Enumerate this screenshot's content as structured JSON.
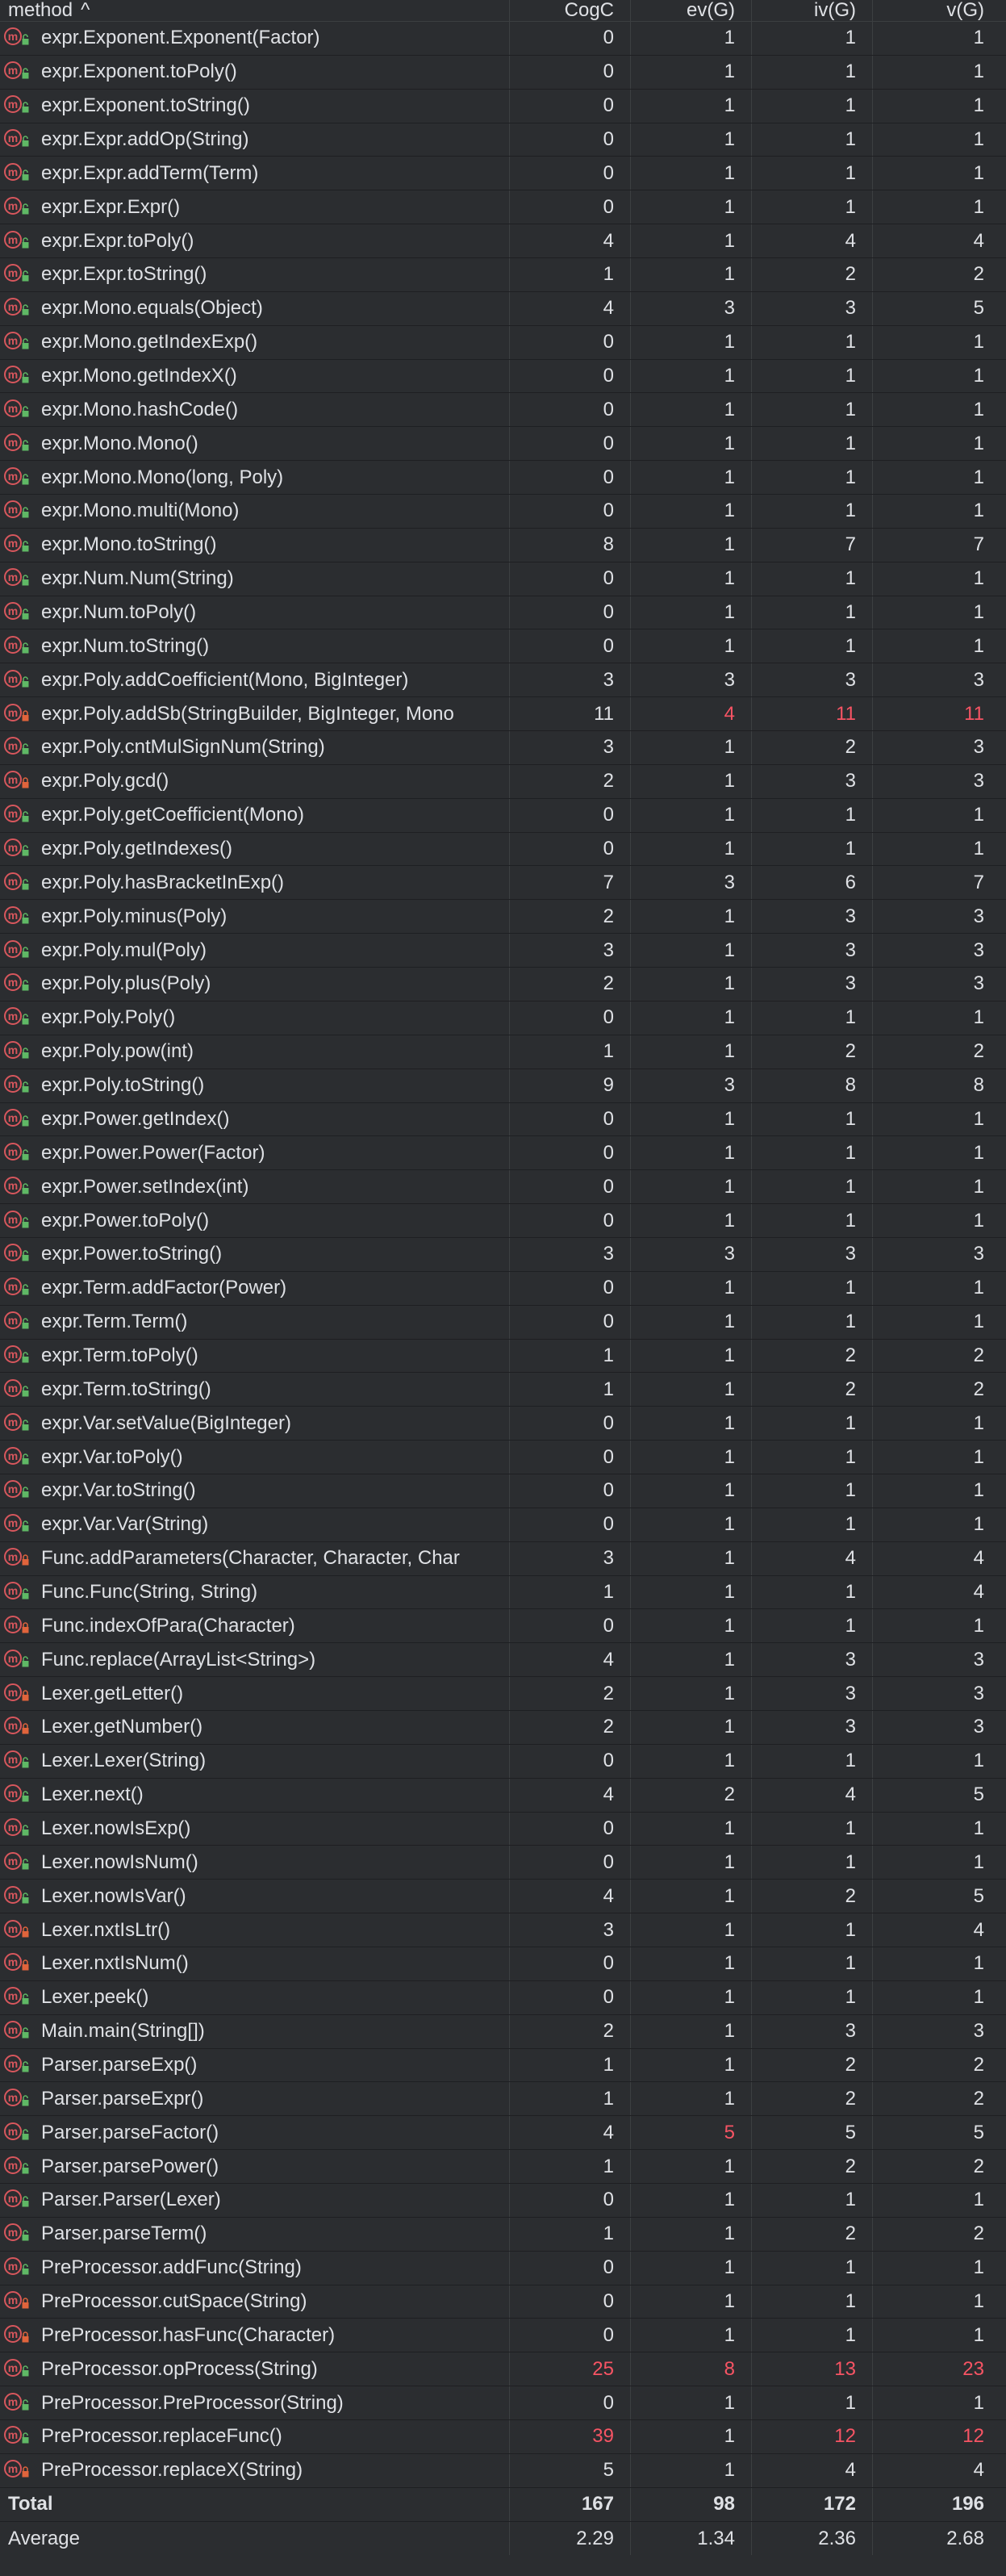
{
  "headers": {
    "method": "method",
    "sort_indicator": "^",
    "cogc": "CogC",
    "evg": "ev(G)",
    "ivg": "iv(G)",
    "vg": "v(G)"
  },
  "colors": {
    "background": "#2b2d30",
    "text": "#dfe1e5",
    "highlight": "#f75464",
    "method_icon": "#d8575d",
    "public_icon": "#5fb865",
    "private_icon": "#e0643c"
  },
  "rows": [
    {
      "name": "expr.Exponent.Exponent(Factor)",
      "vis": "public",
      "cogc": "0",
      "evg": "1",
      "ivg": "1",
      "vg": "1"
    },
    {
      "name": "expr.Exponent.toPoly()",
      "vis": "public",
      "cogc": "0",
      "evg": "1",
      "ivg": "1",
      "vg": "1"
    },
    {
      "name": "expr.Exponent.toString()",
      "vis": "public",
      "cogc": "0",
      "evg": "1",
      "ivg": "1",
      "vg": "1"
    },
    {
      "name": "expr.Expr.addOp(String)",
      "vis": "public",
      "cogc": "0",
      "evg": "1",
      "ivg": "1",
      "vg": "1"
    },
    {
      "name": "expr.Expr.addTerm(Term)",
      "vis": "public",
      "cogc": "0",
      "evg": "1",
      "ivg": "1",
      "vg": "1"
    },
    {
      "name": "expr.Expr.Expr()",
      "vis": "public",
      "cogc": "0",
      "evg": "1",
      "ivg": "1",
      "vg": "1"
    },
    {
      "name": "expr.Expr.toPoly()",
      "vis": "public",
      "cogc": "4",
      "evg": "1",
      "ivg": "4",
      "vg": "4"
    },
    {
      "name": "expr.Expr.toString()",
      "vis": "public",
      "cogc": "1",
      "evg": "1",
      "ivg": "2",
      "vg": "2"
    },
    {
      "name": "expr.Mono.equals(Object)",
      "vis": "public",
      "cogc": "4",
      "evg": "3",
      "ivg": "3",
      "vg": "5"
    },
    {
      "name": "expr.Mono.getIndexExp()",
      "vis": "public",
      "cogc": "0",
      "evg": "1",
      "ivg": "1",
      "vg": "1"
    },
    {
      "name": "expr.Mono.getIndexX()",
      "vis": "public",
      "cogc": "0",
      "evg": "1",
      "ivg": "1",
      "vg": "1"
    },
    {
      "name": "expr.Mono.hashCode()",
      "vis": "public",
      "cogc": "0",
      "evg": "1",
      "ivg": "1",
      "vg": "1"
    },
    {
      "name": "expr.Mono.Mono()",
      "vis": "public",
      "cogc": "0",
      "evg": "1",
      "ivg": "1",
      "vg": "1"
    },
    {
      "name": "expr.Mono.Mono(long, Poly)",
      "vis": "public",
      "cogc": "0",
      "evg": "1",
      "ivg": "1",
      "vg": "1"
    },
    {
      "name": "expr.Mono.multi(Mono)",
      "vis": "public",
      "cogc": "0",
      "evg": "1",
      "ivg": "1",
      "vg": "1"
    },
    {
      "name": "expr.Mono.toString()",
      "vis": "public",
      "cogc": "8",
      "evg": "1",
      "ivg": "7",
      "vg": "7"
    },
    {
      "name": "expr.Num.Num(String)",
      "vis": "public",
      "cogc": "0",
      "evg": "1",
      "ivg": "1",
      "vg": "1"
    },
    {
      "name": "expr.Num.toPoly()",
      "vis": "public",
      "cogc": "0",
      "evg": "1",
      "ivg": "1",
      "vg": "1"
    },
    {
      "name": "expr.Num.toString()",
      "vis": "public",
      "cogc": "0",
      "evg": "1",
      "ivg": "1",
      "vg": "1"
    },
    {
      "name": "expr.Poly.addCoefficient(Mono, BigInteger)",
      "vis": "public",
      "cogc": "3",
      "evg": "3",
      "ivg": "3",
      "vg": "3"
    },
    {
      "name": "expr.Poly.addSb(StringBuilder, BigInteger, Mono",
      "vis": "private",
      "cogc": "11",
      "evg": "4",
      "ivg": "11",
      "vg": "11",
      "red": [
        "evg",
        "ivg",
        "vg"
      ]
    },
    {
      "name": "expr.Poly.cntMulSignNum(String)",
      "vis": "public",
      "cogc": "3",
      "evg": "1",
      "ivg": "2",
      "vg": "3"
    },
    {
      "name": "expr.Poly.gcd()",
      "vis": "private",
      "cogc": "2",
      "evg": "1",
      "ivg": "3",
      "vg": "3"
    },
    {
      "name": "expr.Poly.getCoefficient(Mono)",
      "vis": "public",
      "cogc": "0",
      "evg": "1",
      "ivg": "1",
      "vg": "1"
    },
    {
      "name": "expr.Poly.getIndexes()",
      "vis": "public",
      "cogc": "0",
      "evg": "1",
      "ivg": "1",
      "vg": "1"
    },
    {
      "name": "expr.Poly.hasBracketInExp()",
      "vis": "public",
      "cogc": "7",
      "evg": "3",
      "ivg": "6",
      "vg": "7"
    },
    {
      "name": "expr.Poly.minus(Poly)",
      "vis": "public",
      "cogc": "2",
      "evg": "1",
      "ivg": "3",
      "vg": "3"
    },
    {
      "name": "expr.Poly.mul(Poly)",
      "vis": "public",
      "cogc": "3",
      "evg": "1",
      "ivg": "3",
      "vg": "3"
    },
    {
      "name": "expr.Poly.plus(Poly)",
      "vis": "public",
      "cogc": "2",
      "evg": "1",
      "ivg": "3",
      "vg": "3"
    },
    {
      "name": "expr.Poly.Poly()",
      "vis": "public",
      "cogc": "0",
      "evg": "1",
      "ivg": "1",
      "vg": "1"
    },
    {
      "name": "expr.Poly.pow(int)",
      "vis": "public",
      "cogc": "1",
      "evg": "1",
      "ivg": "2",
      "vg": "2"
    },
    {
      "name": "expr.Poly.toString()",
      "vis": "public",
      "cogc": "9",
      "evg": "3",
      "ivg": "8",
      "vg": "8"
    },
    {
      "name": "expr.Power.getIndex()",
      "vis": "public",
      "cogc": "0",
      "evg": "1",
      "ivg": "1",
      "vg": "1"
    },
    {
      "name": "expr.Power.Power(Factor)",
      "vis": "public",
      "cogc": "0",
      "evg": "1",
      "ivg": "1",
      "vg": "1"
    },
    {
      "name": "expr.Power.setIndex(int)",
      "vis": "public",
      "cogc": "0",
      "evg": "1",
      "ivg": "1",
      "vg": "1"
    },
    {
      "name": "expr.Power.toPoly()",
      "vis": "public",
      "cogc": "0",
      "evg": "1",
      "ivg": "1",
      "vg": "1"
    },
    {
      "name": "expr.Power.toString()",
      "vis": "public",
      "cogc": "3",
      "evg": "3",
      "ivg": "3",
      "vg": "3"
    },
    {
      "name": "expr.Term.addFactor(Power)",
      "vis": "public",
      "cogc": "0",
      "evg": "1",
      "ivg": "1",
      "vg": "1"
    },
    {
      "name": "expr.Term.Term()",
      "vis": "public",
      "cogc": "0",
      "evg": "1",
      "ivg": "1",
      "vg": "1"
    },
    {
      "name": "expr.Term.toPoly()",
      "vis": "public",
      "cogc": "1",
      "evg": "1",
      "ivg": "2",
      "vg": "2"
    },
    {
      "name": "expr.Term.toString()",
      "vis": "public",
      "cogc": "1",
      "evg": "1",
      "ivg": "2",
      "vg": "2"
    },
    {
      "name": "expr.Var.setValue(BigInteger)",
      "vis": "public",
      "cogc": "0",
      "evg": "1",
      "ivg": "1",
      "vg": "1"
    },
    {
      "name": "expr.Var.toPoly()",
      "vis": "public",
      "cogc": "0",
      "evg": "1",
      "ivg": "1",
      "vg": "1"
    },
    {
      "name": "expr.Var.toString()",
      "vis": "public",
      "cogc": "0",
      "evg": "1",
      "ivg": "1",
      "vg": "1"
    },
    {
      "name": "expr.Var.Var(String)",
      "vis": "public",
      "cogc": "0",
      "evg": "1",
      "ivg": "1",
      "vg": "1"
    },
    {
      "name": "Func.addParameters(Character, Character, Char",
      "vis": "private",
      "cogc": "3",
      "evg": "1",
      "ivg": "4",
      "vg": "4"
    },
    {
      "name": "Func.Func(String, String)",
      "vis": "public",
      "cogc": "1",
      "evg": "1",
      "ivg": "1",
      "vg": "4"
    },
    {
      "name": "Func.indexOfPara(Character)",
      "vis": "private",
      "cogc": "0",
      "evg": "1",
      "ivg": "1",
      "vg": "1"
    },
    {
      "name": "Func.replace(ArrayList<String>)",
      "vis": "public",
      "cogc": "4",
      "evg": "1",
      "ivg": "3",
      "vg": "3"
    },
    {
      "name": "Lexer.getLetter()",
      "vis": "private",
      "cogc": "2",
      "evg": "1",
      "ivg": "3",
      "vg": "3"
    },
    {
      "name": "Lexer.getNumber()",
      "vis": "private",
      "cogc": "2",
      "evg": "1",
      "ivg": "3",
      "vg": "3"
    },
    {
      "name": "Lexer.Lexer(String)",
      "vis": "public",
      "cogc": "0",
      "evg": "1",
      "ivg": "1",
      "vg": "1"
    },
    {
      "name": "Lexer.next()",
      "vis": "public",
      "cogc": "4",
      "evg": "2",
      "ivg": "4",
      "vg": "5"
    },
    {
      "name": "Lexer.nowIsExp()",
      "vis": "public",
      "cogc": "0",
      "evg": "1",
      "ivg": "1",
      "vg": "1"
    },
    {
      "name": "Lexer.nowIsNum()",
      "vis": "public",
      "cogc": "0",
      "evg": "1",
      "ivg": "1",
      "vg": "1"
    },
    {
      "name": "Lexer.nowIsVar()",
      "vis": "public",
      "cogc": "4",
      "evg": "1",
      "ivg": "2",
      "vg": "5"
    },
    {
      "name": "Lexer.nxtIsLtr()",
      "vis": "private",
      "cogc": "3",
      "evg": "1",
      "ivg": "1",
      "vg": "4"
    },
    {
      "name": "Lexer.nxtIsNum()",
      "vis": "private",
      "cogc": "0",
      "evg": "1",
      "ivg": "1",
      "vg": "1"
    },
    {
      "name": "Lexer.peek()",
      "vis": "public",
      "cogc": "0",
      "evg": "1",
      "ivg": "1",
      "vg": "1"
    },
    {
      "name": "Main.main(String[])",
      "vis": "public",
      "cogc": "2",
      "evg": "1",
      "ivg": "3",
      "vg": "3"
    },
    {
      "name": "Parser.parseExp()",
      "vis": "public",
      "cogc": "1",
      "evg": "1",
      "ivg": "2",
      "vg": "2"
    },
    {
      "name": "Parser.parseExpr()",
      "vis": "public",
      "cogc": "1",
      "evg": "1",
      "ivg": "2",
      "vg": "2"
    },
    {
      "name": "Parser.parseFactor()",
      "vis": "public",
      "cogc": "4",
      "evg": "5",
      "ivg": "5",
      "vg": "5",
      "red": [
        "evg"
      ]
    },
    {
      "name": "Parser.parsePower()",
      "vis": "public",
      "cogc": "1",
      "evg": "1",
      "ivg": "2",
      "vg": "2"
    },
    {
      "name": "Parser.Parser(Lexer)",
      "vis": "public",
      "cogc": "0",
      "evg": "1",
      "ivg": "1",
      "vg": "1"
    },
    {
      "name": "Parser.parseTerm()",
      "vis": "public",
      "cogc": "1",
      "evg": "1",
      "ivg": "2",
      "vg": "2"
    },
    {
      "name": "PreProcessor.addFunc(String)",
      "vis": "public",
      "cogc": "0",
      "evg": "1",
      "ivg": "1",
      "vg": "1"
    },
    {
      "name": "PreProcessor.cutSpace(String)",
      "vis": "private",
      "cogc": "0",
      "evg": "1",
      "ivg": "1",
      "vg": "1"
    },
    {
      "name": "PreProcessor.hasFunc(Character)",
      "vis": "private",
      "cogc": "0",
      "evg": "1",
      "ivg": "1",
      "vg": "1"
    },
    {
      "name": "PreProcessor.opProcess(String)",
      "vis": "public",
      "cogc": "25",
      "evg": "8",
      "ivg": "13",
      "vg": "23",
      "red": [
        "cogc",
        "evg",
        "ivg",
        "vg"
      ]
    },
    {
      "name": "PreProcessor.PreProcessor(String)",
      "vis": "public",
      "cogc": "0",
      "evg": "1",
      "ivg": "1",
      "vg": "1"
    },
    {
      "name": "PreProcessor.replaceFunc()",
      "vis": "public",
      "cogc": "39",
      "evg": "1",
      "ivg": "12",
      "vg": "12",
      "red": [
        "cogc",
        "ivg",
        "vg"
      ]
    },
    {
      "name": "PreProcessor.replaceX(String)",
      "vis": "private",
      "cogc": "5",
      "evg": "1",
      "ivg": "4",
      "vg": "4"
    }
  ],
  "total": {
    "label": "Total",
    "cogc": "167",
    "evg": "98",
    "ivg": "172",
    "vg": "196"
  },
  "average": {
    "label": "Average",
    "cogc": "2.29",
    "evg": "1.34",
    "ivg": "2.36",
    "vg": "2.68"
  }
}
